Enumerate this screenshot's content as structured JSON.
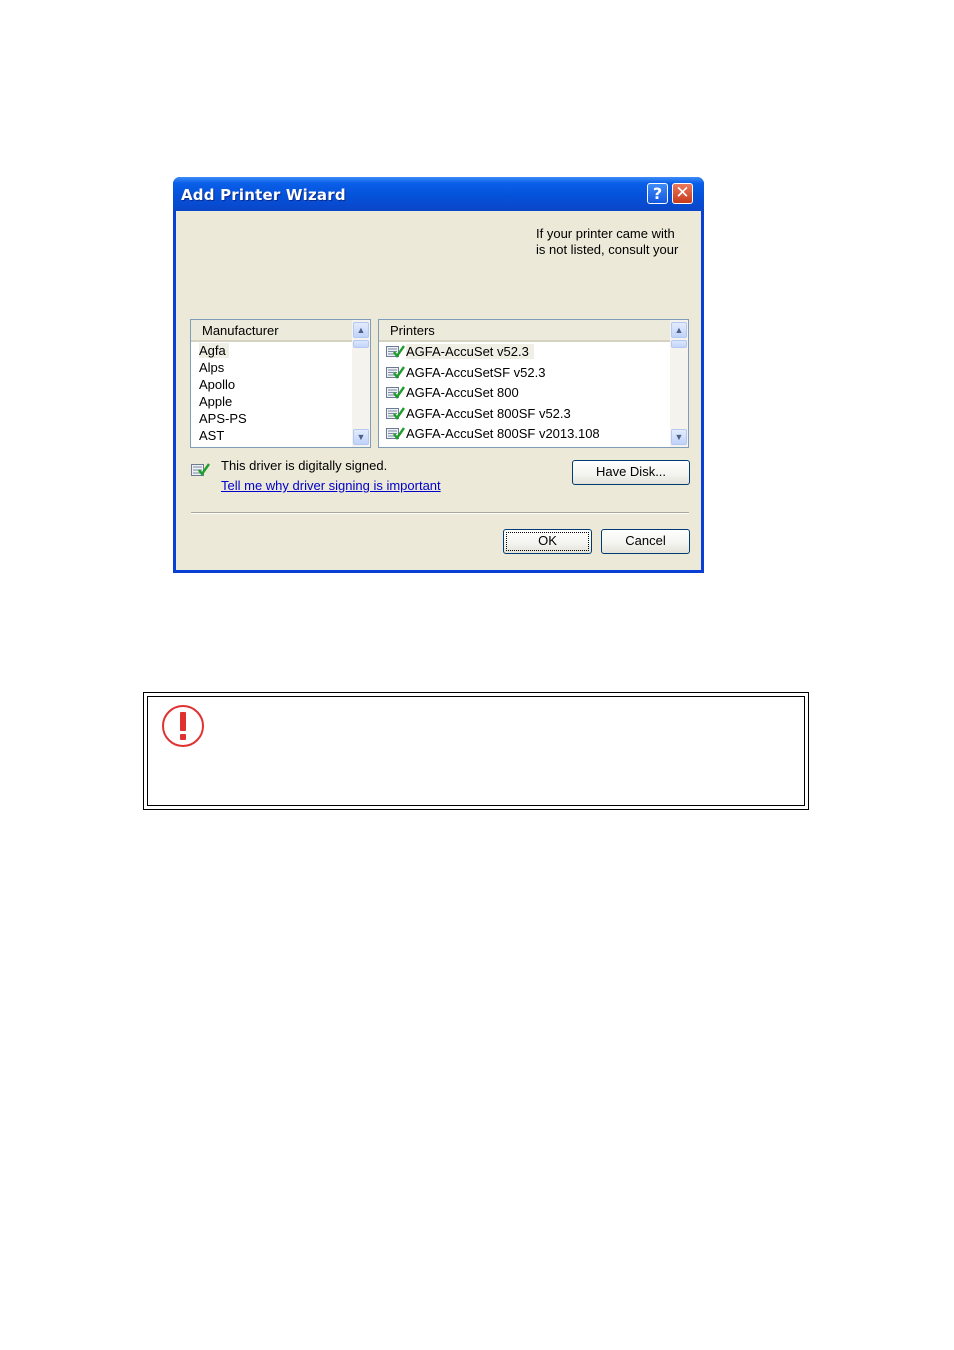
{
  "dialog": {
    "title": "Add Printer Wizard",
    "help_label": "?",
    "close_label": "✕",
    "intro_lines": [
      "If your printer came with",
      "is not listed, consult your"
    ],
    "manufacturer_list": {
      "header": "Manufacturer",
      "items": [
        "Agfa",
        "Alps",
        "Apollo",
        "Apple",
        "APS-PS",
        "AST"
      ],
      "selected": "Agfa"
    },
    "printers_list": {
      "header": "Printers",
      "items": [
        "AGFA-AccuSet v52.3",
        "AGFA-AccuSetSF v52.3",
        "AGFA-AccuSet 800",
        "AGFA-AccuSet 800SF v52.3",
        "AGFA-AccuSet 800SF v2013.108"
      ],
      "selected": "AGFA-AccuSet v52.3"
    },
    "signed_text": "This driver is digitally signed.",
    "signing_link": "Tell me why driver signing is important",
    "have_disk_label": "Have Disk...",
    "ok_label": "OK",
    "cancel_label": "Cancel"
  },
  "note": {
    "icon": "caution-icon",
    "accent_color": "#e03131"
  },
  "colors": {
    "titlebar": "#0552da",
    "client_bg": "#ece9d8",
    "link": "#0000cc"
  }
}
